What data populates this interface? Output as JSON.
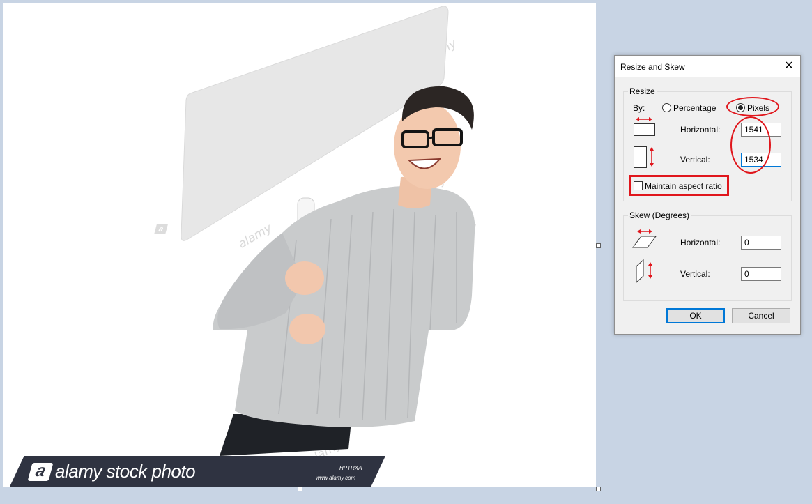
{
  "canvas": {
    "watermark_text": "alamy",
    "watermark_letter": "a",
    "banner": {
      "logo_letter": "a",
      "brand_text": "alamy stock photo",
      "image_id": "HPTRXA",
      "url": "www.alamy.com"
    }
  },
  "dialog": {
    "title": "Resize and Skew",
    "close_glyph": "✕",
    "resize": {
      "label": "Resize",
      "by_label": "By:",
      "percentage_label": "Percentage",
      "pixels_label": "Pixels",
      "selected": "Pixels",
      "horizontal_label": "Horizontal:",
      "horizontal_value": "1541",
      "vertical_label": "Vertical:",
      "vertical_value": "1534",
      "maintain_aspect_label": "Maintain aspect ratio",
      "maintain_aspect_checked": false
    },
    "skew": {
      "label": "Skew (Degrees)",
      "horizontal_label": "Horizontal:",
      "horizontal_value": "0",
      "vertical_label": "Vertical:",
      "vertical_value": "0"
    },
    "ok_label": "OK",
    "cancel_label": "Cancel"
  },
  "colors": {
    "annotation_red": "#e0161c",
    "accent_blue": "#0078d7",
    "banner_bg": "#2f3341",
    "sweater_gray": "#c9cbcc"
  },
  "icons": [
    "resize-horizontal-icon",
    "resize-vertical-icon",
    "skew-horizontal-icon",
    "skew-vertical-icon",
    "close-icon"
  ]
}
